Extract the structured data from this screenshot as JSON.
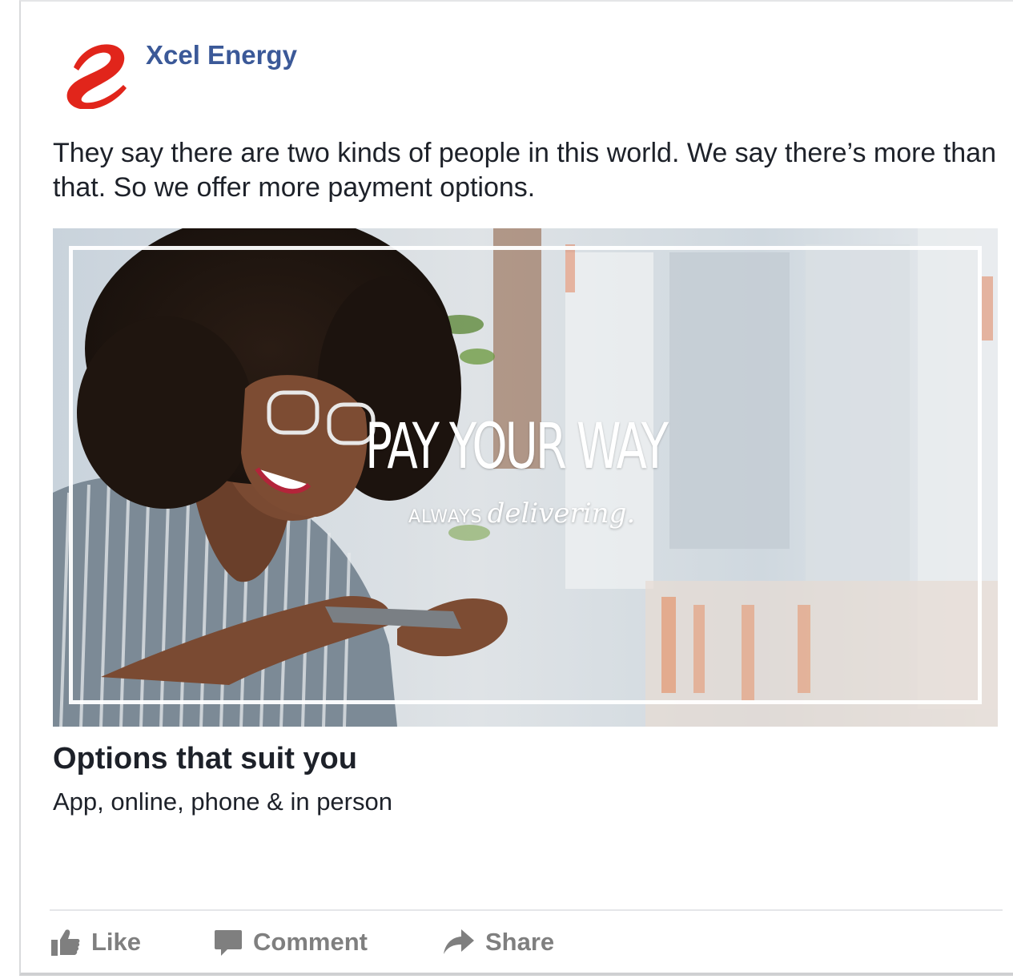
{
  "page": {
    "name": "Xcel Energy",
    "logo_icon": "xcel-swirl-logo",
    "brand_color": "#e1251b",
    "name_color": "#3b5998"
  },
  "post": {
    "text": "They say there are two kinds of people in this world. We say there’s more than that. So we offer more payment options."
  },
  "hero": {
    "title": "PAY YOUR WAY",
    "tagline_small": "ALWAYS",
    "tagline_script": "delivering."
  },
  "link": {
    "title": "Options that suit you",
    "description": "App, online, phone & in person"
  },
  "actions": [
    {
      "label": "Like",
      "icon": "thumbs-up-icon"
    },
    {
      "label": "Comment",
      "icon": "comment-icon"
    },
    {
      "label": "Share",
      "icon": "share-arrow-icon"
    }
  ],
  "colors": {
    "action_gray": "#7f7f7f",
    "text": "#1d2129"
  }
}
